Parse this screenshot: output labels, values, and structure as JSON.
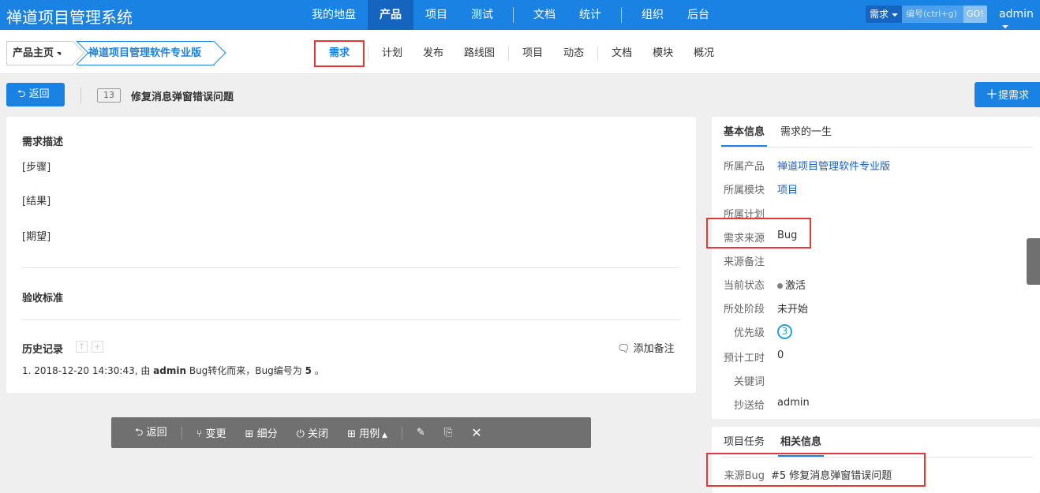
{
  "topbar": {
    "logo": "禅道项目管理系统",
    "nav": [
      "我的地盘",
      "产品",
      "项目",
      "测试",
      "文档",
      "统计",
      "组织",
      "后台"
    ],
    "active_nav": "产品",
    "search_type": "需求",
    "search_placeholder": "编号(ctrl+g)",
    "go_label": "GO!",
    "user": "admin"
  },
  "subbar": {
    "crumb_home": "产品主页",
    "crumb_product": "禅道项目管理软件专业版",
    "nav": [
      "需求",
      "计划",
      "发布",
      "路线图",
      "项目",
      "动态",
      "文档",
      "模块",
      "概况"
    ],
    "active_nav": "需求"
  },
  "titlebar": {
    "back_label": "返回",
    "story_id": "13",
    "story_title": "修复消息弹窗错误问题",
    "add_label": "提需求"
  },
  "main": {
    "desc_title": "需求描述",
    "steps": "[步骤]",
    "result": "[结果]",
    "expect": "[期望]",
    "verify_title": "验收标准",
    "history_title": "历史记录",
    "add_note": "添加备注",
    "history_item_prefix": "1. 2018-12-20 14:30:43, 由 ",
    "history_user": "admin",
    "history_item_mid": " Bug转化而来，Bug编号为 ",
    "history_bug_no": "5",
    "history_item_suffix": " 。"
  },
  "toolbar": {
    "back": "返回",
    "change": "变更",
    "split": "细分",
    "close": "关闭",
    "case": "用例"
  },
  "info": {
    "tab_basic": "基本信息",
    "tab_life": "需求的一生",
    "rows": [
      {
        "k": "所属产品",
        "v": "禅道项目管理软件专业版"
      },
      {
        "k": "所属模块",
        "v": "项目"
      },
      {
        "k": "所属计划",
        "v": ""
      },
      {
        "k": "需求来源",
        "v": "Bug"
      },
      {
        "k": "来源备注",
        "v": ""
      },
      {
        "k": "当前状态",
        "v": "激活"
      },
      {
        "k": "所处阶段",
        "v": "未开始"
      },
      {
        "k": "优先级",
        "v": "3"
      },
      {
        "k": "预计工时",
        "v": "0"
      },
      {
        "k": "关键词",
        "v": ""
      },
      {
        "k": "抄送给",
        "v": "admin"
      }
    ]
  },
  "related": {
    "tab_tasks": "项目任务",
    "tab_related": "相关信息",
    "source_bug_label": "来源Bug",
    "source_bug_value": "#5 修复消息弹窗错误问题"
  },
  "colors": {
    "primary": "#1a82e2",
    "highlight_box": "#e53935",
    "toolbar_bg": "#707070"
  }
}
